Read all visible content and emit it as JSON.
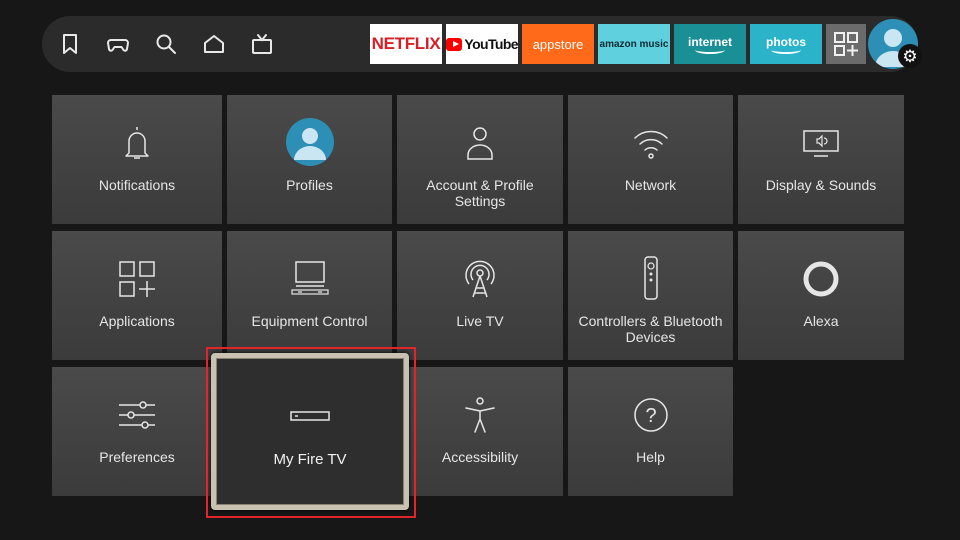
{
  "topbar": {
    "nav": [
      "bookmark-icon",
      "gamepad-icon",
      "search-icon",
      "home-icon",
      "live-tv-icon"
    ],
    "apps": {
      "netflix": "NETFLIX",
      "youtube": "YouTube",
      "appstore": "appstore",
      "music": "amazon music",
      "internet": "internet",
      "photos": "photos"
    }
  },
  "settings": {
    "tiles": [
      {
        "label": "Notifications",
        "icon": "bell-icon"
      },
      {
        "label": "Profiles",
        "icon": "profile-avatar-icon"
      },
      {
        "label": "Account & Profile Settings",
        "icon": "person-icon"
      },
      {
        "label": "Network",
        "icon": "wifi-icon"
      },
      {
        "label": "Display & Sounds",
        "icon": "display-sound-icon"
      },
      {
        "label": "Applications",
        "icon": "applications-icon"
      },
      {
        "label": "Equipment Control",
        "icon": "tv-equipment-icon"
      },
      {
        "label": "Live TV",
        "icon": "antenna-icon"
      },
      {
        "label": "Controllers & Bluetooth Devices",
        "icon": "remote-icon"
      },
      {
        "label": "Alexa",
        "icon": "alexa-ring-icon"
      },
      {
        "label": "Preferences",
        "icon": "sliders-icon"
      },
      {
        "label": "My Fire TV",
        "icon": "fire-tv-device-icon"
      },
      {
        "label": "Accessibility",
        "icon": "accessibility-icon"
      },
      {
        "label": "Help",
        "icon": "help-icon"
      }
    ],
    "focused": "My Fire TV"
  },
  "colors": {
    "background": "#171717",
    "tile": "#434343",
    "focus_border": "#c9c2b3",
    "highlight": "#e0262b"
  }
}
